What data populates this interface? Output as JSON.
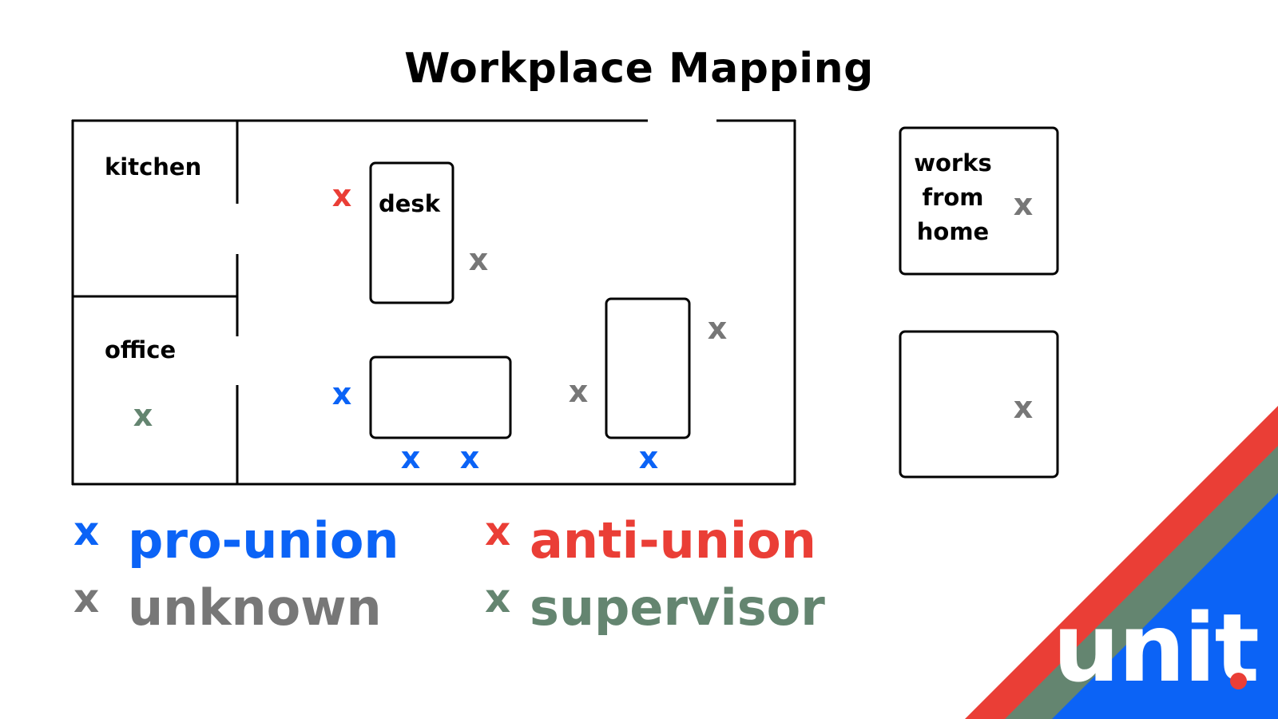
{
  "title": "Workplace Mapping",
  "colors": {
    "pro_union": "#0b63f6",
    "anti_union": "#ea3e36",
    "unknown": "#777777",
    "supervisor": "#648570",
    "wall": "#000000",
    "logo_text": "#ffffff"
  },
  "floorplan": {
    "rooms": [
      {
        "id": "kitchen",
        "label": "kitchen"
      },
      {
        "id": "office",
        "label": "office"
      }
    ],
    "desks": [
      {
        "id": "desk-1",
        "label": "desk"
      },
      {
        "id": "desk-2",
        "label": ""
      },
      {
        "id": "desk-3",
        "label": ""
      }
    ],
    "marker_glyph": "x",
    "markers": [
      {
        "location": "left of desk",
        "category": "anti_union"
      },
      {
        "location": "right of desk",
        "category": "unknown"
      },
      {
        "location": "office",
        "category": "supervisor"
      },
      {
        "location": "left of horizontal desk",
        "category": "pro_union"
      },
      {
        "location": "below horizontal desk (left)",
        "category": "pro_union"
      },
      {
        "location": "below horizontal desk (right)",
        "category": "pro_union"
      },
      {
        "location": "left of tall desk",
        "category": "unknown"
      },
      {
        "location": "right of tall desk",
        "category": "unknown"
      },
      {
        "location": "below tall desk",
        "category": "pro_union"
      }
    ]
  },
  "remote_boxes": [
    {
      "id": "works-from-home",
      "label_lines": [
        "works",
        "from",
        "home"
      ],
      "marker_category": "unknown"
    },
    {
      "id": "other-box",
      "label_lines": [],
      "marker_category": "unknown"
    }
  ],
  "legend": [
    {
      "category": "pro_union",
      "glyph": "x",
      "label": "pro-union"
    },
    {
      "category": "anti_union",
      "glyph": "x",
      "label": "anti-union"
    },
    {
      "category": "unknown",
      "glyph": "x",
      "label": "unknown"
    },
    {
      "category": "supervisor",
      "glyph": "x",
      "label": "supervisor"
    }
  ],
  "logo": {
    "text": "unit",
    "dot": ".",
    "stripe_colors": [
      "#ea3e36",
      "#648570",
      "#0b63f6"
    ]
  }
}
